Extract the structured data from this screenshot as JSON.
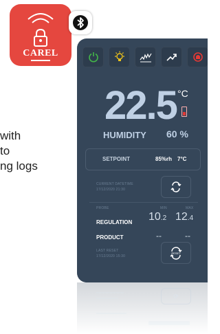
{
  "app_icon": {
    "brand": "CAREL",
    "color": "#e5473f",
    "icons": [
      "wifi-icon",
      "lock-icon"
    ]
  },
  "badge": {
    "icon": "bluetooth-icon"
  },
  "side_text": [
    "with",
    "to",
    "ng logs"
  ],
  "device": {
    "toolbar": [
      {
        "name": "power-icon",
        "color": "#43b649",
        "active": false
      },
      {
        "name": "light-bulb-icon",
        "color": "#f0c419",
        "active": true
      },
      {
        "name": "chart-noise-icon",
        "color": "#ffffff",
        "active": false
      },
      {
        "name": "trend-icon",
        "color": "#ffffff",
        "active": false
      },
      {
        "name": "alarm-icon",
        "color": "#e53935",
        "active": false
      }
    ],
    "temperature": "22.5",
    "temperature_unit": "°C",
    "battery_level": 0.35,
    "humidity_label": "HUMIDITY",
    "humidity_value": "60 %",
    "setpoint": {
      "label": "SETPOINT",
      "humidity": "85%rh",
      "temperature": "7°C"
    },
    "current_datetime": {
      "label": "CURRENT DATETIME",
      "value": "17/12/2020 21:30"
    },
    "probe": {
      "label": "PROBE",
      "min_label": "MIN",
      "max_label": "MAX",
      "rows": [
        {
          "label": "REGULATION",
          "min_main": "10",
          "min_dec": ".2",
          "max_main": "12",
          "max_dec": ".4"
        },
        {
          "label": "PRODUCT",
          "min": "--",
          "max": "--"
        }
      ]
    },
    "last_reset": {
      "label": "LAST RESET",
      "value": "17/12/2020 15:30",
      "button_text": "RESET"
    }
  }
}
